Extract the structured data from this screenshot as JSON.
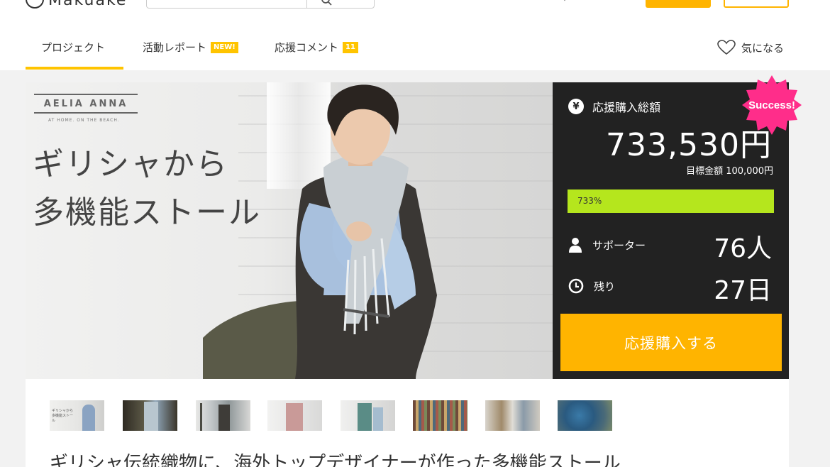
{
  "header": {
    "logo_text": "Makuake"
  },
  "tabs": [
    {
      "label": "プロジェクト",
      "badge": ""
    },
    {
      "label": "活動レポート",
      "badge": "NEW!"
    },
    {
      "label": "応援コメント",
      "badge": "11"
    }
  ],
  "favorite": {
    "label": "気になる"
  },
  "hero": {
    "brand": "AELIA ANNA",
    "brand_tagline": "AT HOME. ON THE BEACH.",
    "title": "ギリシャから\n多機能ストール"
  },
  "stats": {
    "total_label": "応援購入総額",
    "total_amount": "733,530円",
    "goal_text": "目標金額 100,000円",
    "progress_label": "733%",
    "progress_fraction": 1.0,
    "supporters_label": "サポーター",
    "supporters_value": "76人",
    "remaining_label": "残り",
    "remaining_value": "27日",
    "cta_label": "応援購入する",
    "success_badge": "Success!"
  },
  "thumbnails": [
    {
      "name": "thumb-1",
      "caption": "ギリシャから多機能ストール"
    },
    {
      "name": "thumb-2"
    },
    {
      "name": "thumb-3"
    },
    {
      "name": "thumb-4"
    },
    {
      "name": "thumb-5"
    },
    {
      "name": "thumb-6"
    },
    {
      "name": "thumb-7"
    },
    {
      "name": "thumb-8"
    }
  ],
  "headline": "ギリシャ伝統織物に、海外トップデザイナーが作った多機能ストール",
  "colors": {
    "accent": "#ffb400",
    "tab_underline": "#ffc400",
    "progress": "#b5e61d",
    "panel_bg": "#222222",
    "success": "#ff2d8a"
  },
  "icons": {
    "search": "search-icon",
    "heart": "heart-icon",
    "yen": "yen-icon",
    "person": "person-icon",
    "clock": "clock-icon"
  }
}
